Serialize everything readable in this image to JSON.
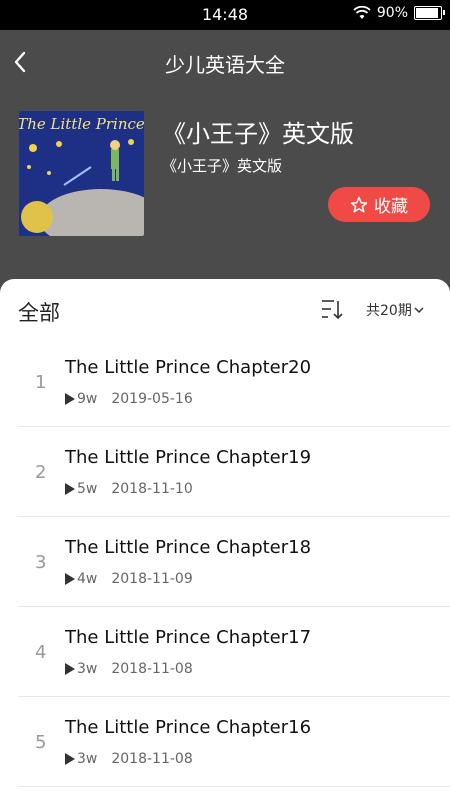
{
  "status": {
    "time": "14:48",
    "battery": "90%"
  },
  "header": {
    "title": "少儿英语大全"
  },
  "album": {
    "cover_text": "The Little Prince",
    "title": "《小王子》英文版",
    "subtitle": "《小王子》英文版",
    "collect_label": "收藏"
  },
  "list": {
    "heading": "全部",
    "count_label": "共20期",
    "items": [
      {
        "index": "1",
        "title": "The Little Prince Chapter20",
        "plays": "9w",
        "date": "2019-05-16"
      },
      {
        "index": "2",
        "title": "The Little Prince Chapter19",
        "plays": "5w",
        "date": "2018-11-10"
      },
      {
        "index": "3",
        "title": "The Little Prince Chapter18",
        "plays": "4w",
        "date": "2018-11-09"
      },
      {
        "index": "4",
        "title": "The Little Prince Chapter17",
        "plays": "3w",
        "date": "2018-11-08"
      },
      {
        "index": "5",
        "title": "The Little Prince Chapter16",
        "plays": "3w",
        "date": "2018-11-08"
      }
    ]
  },
  "colors": {
    "accent": "#f04a46",
    "header_bg": "#4b4b4b",
    "cover_bg": "#1e2f86"
  },
  "icons": [
    "wifi-icon",
    "battery-icon",
    "back-arrow-icon",
    "star-outline-icon",
    "sort-icon",
    "chevron-down-icon",
    "play-icon"
  ]
}
